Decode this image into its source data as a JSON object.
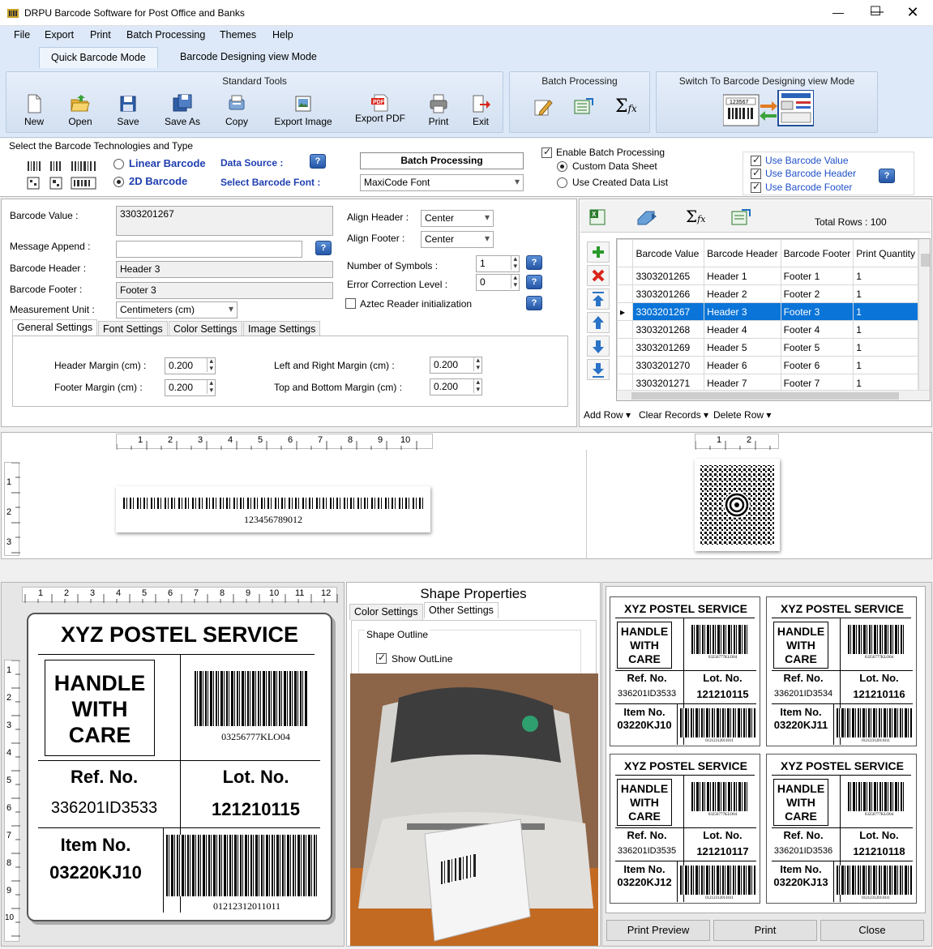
{
  "window": {
    "title": "DRPU Barcode Software for Post Office and Banks"
  },
  "menu": [
    "File",
    "Export",
    "Print",
    "Batch Processing",
    "Themes",
    "Help"
  ],
  "mode_tabs": [
    "Quick Barcode Mode",
    "Barcode Designing view Mode"
  ],
  "ribbon": {
    "standard_title": "Standard Tools",
    "tools": [
      "New",
      "Open",
      "Save",
      "Save As",
      "Copy",
      "Export Image",
      "Export PDF",
      "Print",
      "Exit"
    ],
    "batch_title": "Batch Processing",
    "switch_title": "Switch To Barcode Designing view Mode"
  },
  "tech": {
    "title": "Select the Barcode Technologies and Type",
    "linear": "Linear Barcode",
    "twod": "2D Barcode",
    "data_source": "Data Source :",
    "select_font": "Select Barcode Font :",
    "batch_btn": "Batch Processing",
    "font_value": "MaxiCode Font",
    "enable_batch": "Enable Batch Processing",
    "custom_sheet": "Custom Data Sheet",
    "created_list": "Use Created Data List",
    "use_value": "Use Barcode Value",
    "use_header": "Use Barcode Header",
    "use_footer": "Use Barcode Footer"
  },
  "form": {
    "barcode_value_label": "Barcode Value :",
    "barcode_value": "3303201267",
    "message_append_label": "Message Append :",
    "barcode_header_label": "Barcode Header :",
    "barcode_header": "Header 3",
    "barcode_footer_label": "Barcode Footer :",
    "barcode_footer": "Footer 3",
    "unit_label": "Measurement Unit :",
    "unit": "Centimeters (cm)",
    "align_header_label": "Align Header :",
    "align_header": "Center",
    "align_footer_label": "Align Footer :",
    "align_footer": "Center",
    "symbols_label": "Number of Symbols :",
    "symbols": "1",
    "ecl_label": "Error Correction Level :",
    "ecl": "0",
    "aztec": "Aztec Reader initialization",
    "tabs": [
      "General Settings",
      "Font Settings",
      "Color Settings",
      "Image Settings"
    ],
    "header_margin_label": "Header Margin (cm) :",
    "header_margin": "0.200",
    "footer_margin_label": "Footer Margin (cm) :",
    "footer_margin": "0.200",
    "lr_margin_label": "Left  and Right Margin (cm) :",
    "lr_margin": "0.200",
    "tb_margin_label": "Top and Bottom Margin (cm) :",
    "tb_margin": "0.200"
  },
  "grid": {
    "total_rows": "Total Rows : 100",
    "columns": [
      "Barcode Value",
      "Barcode Header",
      "Barcode Footer",
      "Print Quantity"
    ],
    "rows": [
      [
        "3303201265",
        "Header 1",
        "Footer 1",
        "1"
      ],
      [
        "3303201266",
        "Header 2",
        "Footer 2",
        "1"
      ],
      [
        "3303201267",
        "Header 3",
        "Footer 3",
        "1"
      ],
      [
        "3303201268",
        "Header 4",
        "Footer 4",
        "1"
      ],
      [
        "3303201269",
        "Header 5",
        "Footer 5",
        "1"
      ],
      [
        "3303201270",
        "Header 6",
        "Footer 6",
        "1"
      ],
      [
        "3303201271",
        "Header 7",
        "Footer 7",
        "1"
      ]
    ],
    "actions": [
      "Add Row",
      "Clear Records",
      "Delete Row"
    ]
  },
  "preview": {
    "ruler_top": [
      "1",
      "2",
      "3",
      "4",
      "5",
      "6",
      "7",
      "8",
      "9",
      "10"
    ],
    "ruler_right": [
      "1",
      "2"
    ],
    "ruler_left": [
      "1",
      "2",
      "3"
    ],
    "linear_text": "123456789012"
  },
  "label": {
    "ruler_top": [
      "1",
      "2",
      "3",
      "4",
      "5",
      "6",
      "7",
      "8",
      "9",
      "10",
      "11",
      "12"
    ],
    "ruler_left": [
      "1",
      "2",
      "3",
      "4",
      "5",
      "6",
      "7",
      "8",
      "9",
      "10"
    ],
    "service": "XYZ POSTEL SERVICE",
    "handle1": "HANDLE",
    "handle2": "WITH",
    "handle3": "CARE",
    "code1": "03256777KLO04",
    "ref": "Ref. No.",
    "ref_val": "336201ID3533",
    "lot": "Lot. No.",
    "lot_val": "121210115",
    "item": "Item No.",
    "item_val": "03220KJ10",
    "code2": "01212312011011"
  },
  "shape": {
    "title": "Shape Properties",
    "tabs": [
      "Color Settings",
      "Other Settings"
    ],
    "outline": "Shape Outline",
    "show_outline": "Show OutLine"
  },
  "sheet": {
    "cards": [
      {
        "ref": "336201ID3533",
        "lot": "121210115",
        "item": "03220KJ10"
      },
      {
        "ref": "336201ID3534",
        "lot": "121210116",
        "item": "03220KJ11"
      },
      {
        "ref": "336201ID3535",
        "lot": "121210117",
        "item": "03220KJ12"
      },
      {
        "ref": "336201ID3536",
        "lot": "121210118",
        "item": "03220KJ13"
      }
    ],
    "buttons": [
      "Print Preview",
      "Print",
      "Close"
    ]
  }
}
